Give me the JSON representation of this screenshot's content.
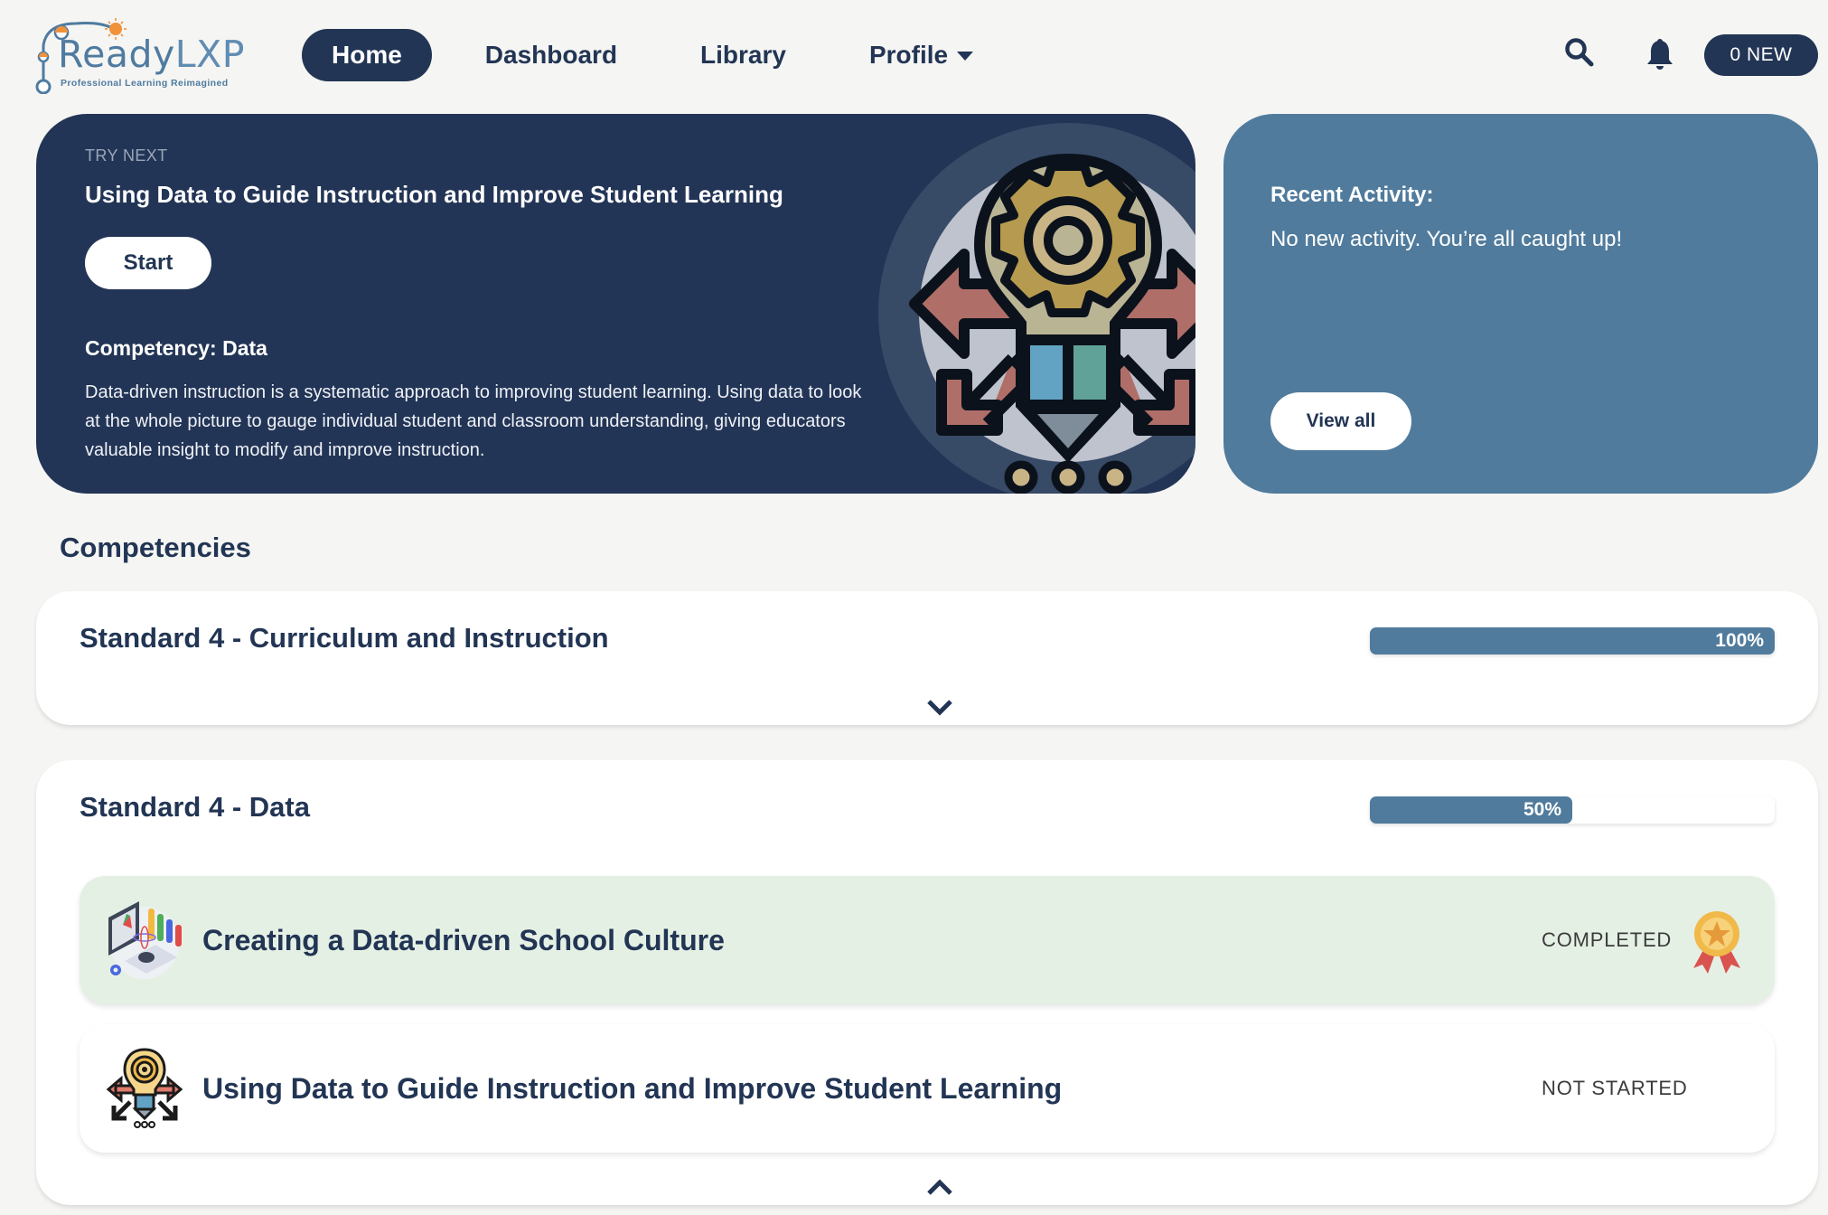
{
  "header": {
    "logo": {
      "name": "ReadyLXP",
      "name_part1": "Ready",
      "name_part2": "LXP",
      "tagline": "Professional Learning Reimagined"
    },
    "nav": [
      {
        "label": "Home",
        "active": true
      },
      {
        "label": "Dashboard",
        "active": false
      },
      {
        "label": "Library",
        "active": false
      },
      {
        "label": "Profile",
        "active": false,
        "has_dropdown": true
      }
    ],
    "icons": {
      "search": "search-icon",
      "notifications": "bell-icon"
    },
    "notification_badge": "0 NEW"
  },
  "hero": {
    "eyebrow": "TRY NEXT",
    "title": "Using Data to Guide Instruction and Improve Student Learning",
    "start_label": "Start",
    "competency": "Competency: Data",
    "description": "Data-driven instruction is a systematic approach to improving student learning. Using data to look at the whole picture to gauge individual student and classroom understanding, giving educators valuable insight to modify and improve instruction.",
    "illustration": "lightbulb-gear-arrows-illustration"
  },
  "activity": {
    "title": "Recent Activity:",
    "message": "No new activity. You’re all caught up!",
    "view_all_label": "View all"
  },
  "competencies": {
    "section_title": "Competencies",
    "cards": [
      {
        "title": "Standard 4 - Curriculum and Instruction",
        "progress_percent": 100,
        "progress_label": "100%",
        "expanded": false,
        "toggle_icon": "chevron-down-icon"
      },
      {
        "title": "Standard 4 - Data",
        "progress_percent": 50,
        "progress_label": "50%",
        "expanded": true,
        "toggle_icon": "chevron-up-icon",
        "modules": [
          {
            "title": "Creating a Data-driven School Culture",
            "status": "COMPLETED",
            "icon": "data-dashboard-icon",
            "badge": "award-medal-icon"
          },
          {
            "title": "Using Data to Guide Instruction and Improve Student Learning",
            "status": "NOT STARTED",
            "icon": "lightbulb-gear-icon"
          }
        ]
      }
    ]
  },
  "colors": {
    "navy": "#223554",
    "steel_blue": "#507b9c",
    "page_bg": "#f5f5f3",
    "completed_bg": "#e5f0e5",
    "logo_orange": "#f0923a"
  }
}
